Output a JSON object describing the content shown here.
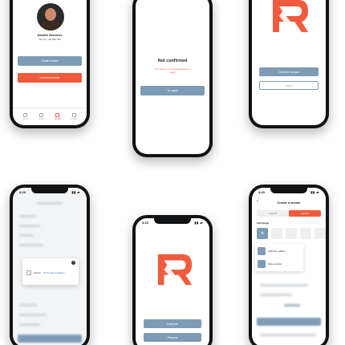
{
  "colors": {
    "accent_red": "#f05b3e",
    "accent_blue": "#7e9bb5",
    "phone_frame": "#111214"
  },
  "profile_screen": {
    "user_name": "Azizbek Davronov",
    "user_phone": "Tas No: 120 990 968",
    "create_tender_label": "Create a tender",
    "second_button_label": "Submit the tender",
    "tabs": [
      "Home",
      "Orders",
      "Tender",
      "Profile"
    ]
  },
  "not_confirmed_screen": {
    "title": "Not confirmed",
    "message": "Your card is not confirmed please try again",
    "try_again_label": "Try again"
  },
  "auth_screen": {
    "create_account_label": "Create an account",
    "login_label": "Log in"
  },
  "terms_screen": {
    "time": "4:20",
    "accept_text": "Accept",
    "terms_link": "Terms and conditions"
  },
  "splash_screen": {
    "time": "4:20",
    "button1_label": "Enterprise",
    "button2_label": "Personal"
  },
  "create_tender_screen": {
    "time": "4:20",
    "title": "Create a tender",
    "seg_left": "Area fill",
    "seg_right": "Manual",
    "add_image_label": "Add Image",
    "add_from_gallery": "Add from gallery",
    "take_photo": "Take a photo"
  }
}
